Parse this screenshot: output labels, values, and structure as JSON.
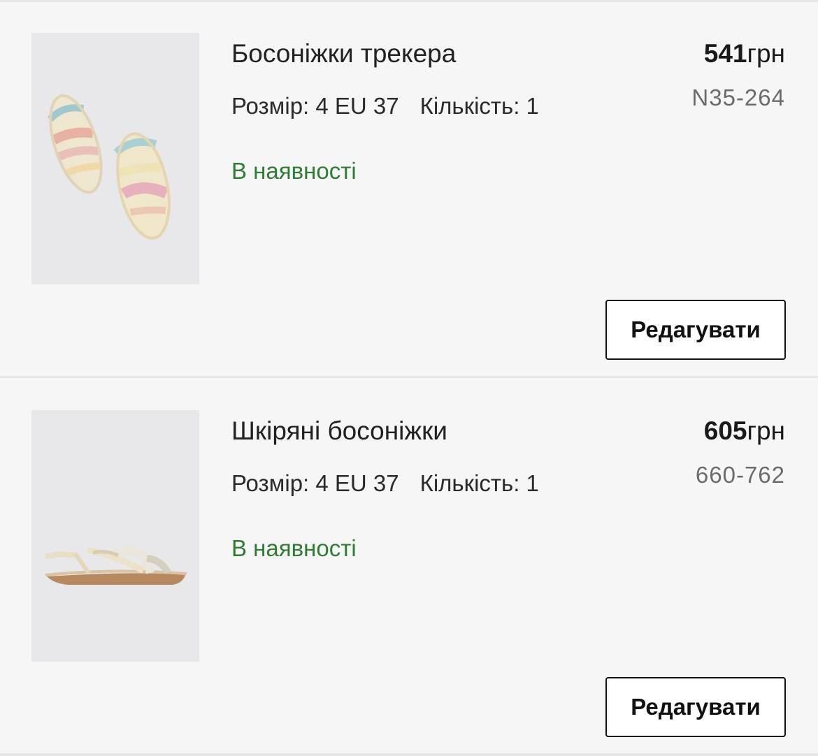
{
  "items": [
    {
      "name": "Босоніжки трекера",
      "size": "Розмір: 4 EU 37",
      "quantity": "Кількість: 1",
      "stock": "В наявності",
      "price": "541",
      "currency": "грн",
      "sku": "N35-264",
      "edit_label": "Редагувати",
      "image_icon": "sandal-trekker-image"
    },
    {
      "name": "Шкіряні босоніжки",
      "size": "Розмір: 4 EU 37",
      "quantity": "Кількість: 1",
      "stock": "В наявності",
      "price": "605",
      "currency": "грн",
      "sku": "660-762",
      "edit_label": "Редагувати",
      "image_icon": "sandal-leather-image"
    }
  ],
  "colors": {
    "stock_green": "#2e7d32",
    "background": "#f6f6f6",
    "divider": "#e6e6e6"
  }
}
